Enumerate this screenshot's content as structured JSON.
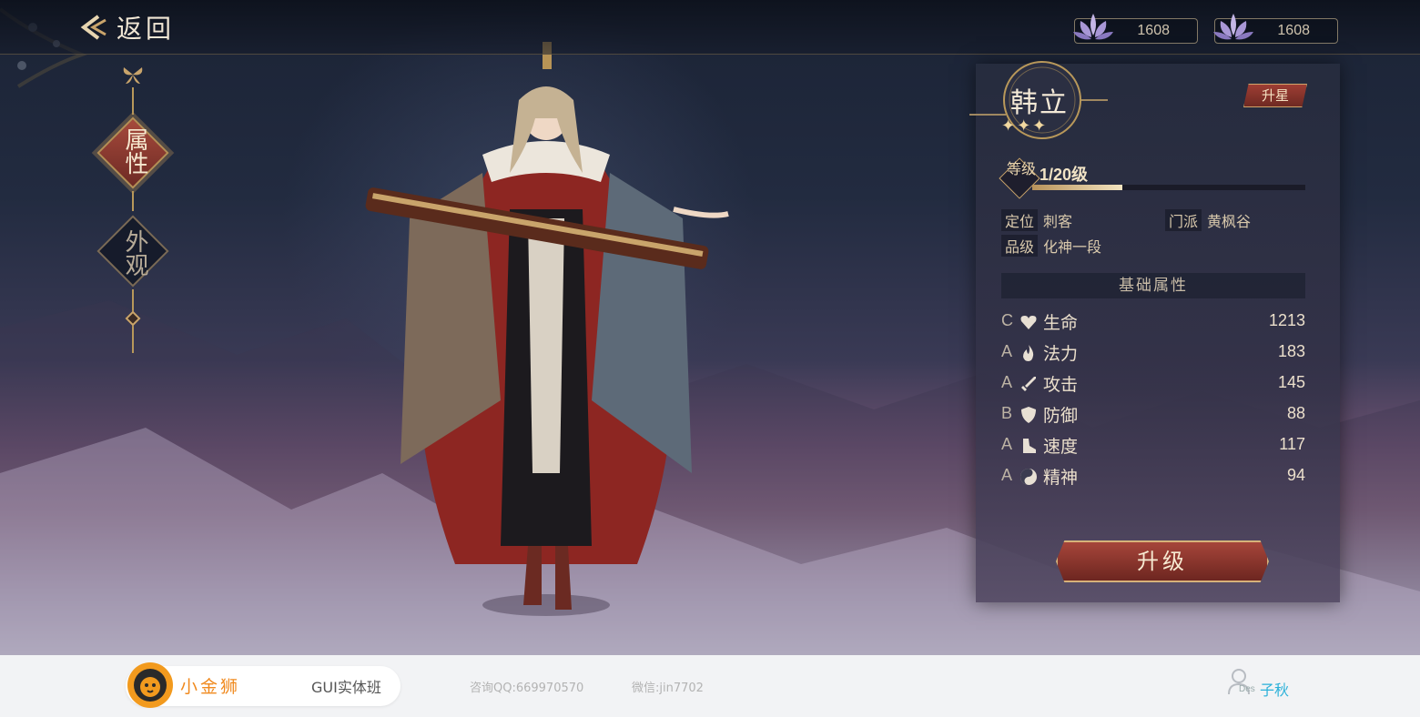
{
  "topbar": {
    "back_label": "返回"
  },
  "currencies": [
    {
      "icon": "lotus-icon",
      "value": "1608"
    },
    {
      "icon": "lotus-icon",
      "value": "1608"
    }
  ],
  "nav": {
    "tabs": [
      {
        "label": "属性",
        "active": true
      },
      {
        "label": "外观",
        "active": false
      }
    ]
  },
  "hero": {
    "name": "韩立",
    "stars": "✦✦✦",
    "star_up_label": "升星",
    "level_badge": "等级",
    "level_text": "1/20级",
    "level_progress": 0.33,
    "info": [
      {
        "key": "定位",
        "value": "刺客"
      },
      {
        "key": "门派",
        "value": "黄枫谷"
      },
      {
        "key": "品级",
        "value": "化神一段"
      }
    ]
  },
  "attributes": {
    "header": "基础属性",
    "rows": [
      {
        "grade": "C",
        "icon": "heart-icon",
        "name": "生命",
        "value": "1213"
      },
      {
        "grade": "A",
        "icon": "flame-icon",
        "name": "法力",
        "value": "183"
      },
      {
        "grade": "A",
        "icon": "sword-icon",
        "name": "攻击",
        "value": "145"
      },
      {
        "grade": "B",
        "icon": "shield-icon",
        "name": "防御",
        "value": "88"
      },
      {
        "grade": "A",
        "icon": "boot-icon",
        "name": "速度",
        "value": "117"
      },
      {
        "grade": "A",
        "icon": "yinyang-icon",
        "name": "精神",
        "value": "94"
      }
    ]
  },
  "upgrade_label": "升级",
  "footer": {
    "brand_name": "小金狮",
    "brand_class": "GUI实体班",
    "qq": "咨询QQ:669970570",
    "wechat": "微信:jin7702",
    "user_des": "Des",
    "user_name": "子秋"
  },
  "colors": {
    "accent_red": "#8e342b",
    "gold": "#d7b279",
    "brand_orange": "#f08a1f",
    "user_blue": "#2bb1d9"
  }
}
